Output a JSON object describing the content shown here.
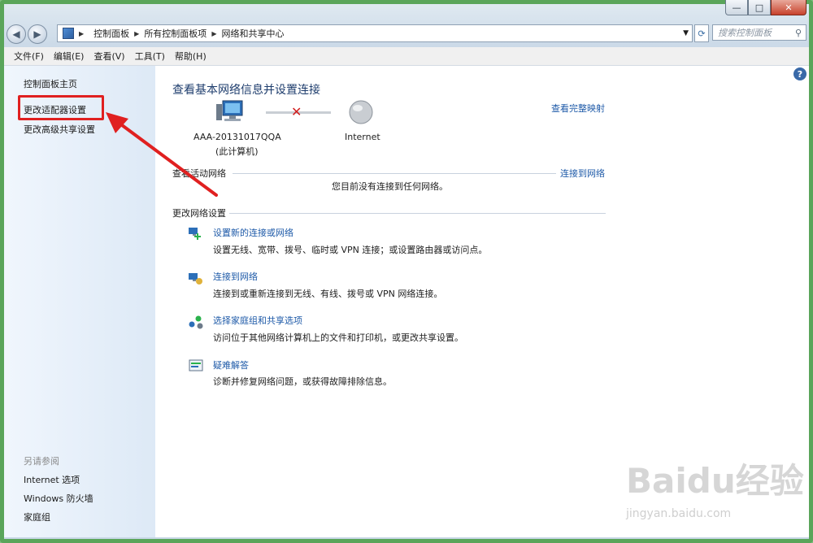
{
  "window": {
    "controls": {
      "minimize": "—",
      "maximize": "□",
      "close": "✕"
    }
  },
  "address_bar": {
    "crumbs": [
      "控制面板",
      "所有控制面板项",
      "网络和共享中心"
    ],
    "search_placeholder": "搜索控制面板"
  },
  "menu": [
    "文件(F)",
    "编辑(E)",
    "查看(V)",
    "工具(T)",
    "帮助(H)"
  ],
  "sidebar": {
    "links": [
      "控制面板主页",
      "更改适配器设置",
      "更改高级共享设置"
    ],
    "see_also_heading": "另请参阅",
    "see_also": [
      "Internet 选项",
      "Windows 防火墙",
      "家庭组"
    ]
  },
  "main": {
    "title": "查看基本网络信息并设置连接",
    "view_full_map": "查看完整映射",
    "computer_name": "AAA-20131017QQA",
    "computer_sub": "(此计算机)",
    "internet_label": "Internet",
    "active_networks_label": "查看活动网络",
    "connect_link": "连接到网络",
    "no_network_text": "您目前没有连接到任何网络。",
    "change_settings_label": "更改网络设置",
    "tasks": [
      {
        "title": "设置新的连接或网络",
        "desc": "设置无线、宽带、拨号、临时或 VPN 连接；或设置路由器或访问点。"
      },
      {
        "title": "连接到网络",
        "desc": "连接到或重新连接到无线、有线、拨号或 VPN 网络连接。"
      },
      {
        "title": "选择家庭组和共享选项",
        "desc": "访问位于其他网络计算机上的文件和打印机，或更改共享设置。"
      },
      {
        "title": "疑难解答",
        "desc": "诊断并修复网络问题，或获得故障排除信息。"
      }
    ]
  },
  "watermark": {
    "brand": "Baidu经验",
    "url": "jingyan.baidu.com"
  },
  "colors": {
    "annotation_red": "#e02020",
    "link_blue": "#1e5aa8"
  }
}
